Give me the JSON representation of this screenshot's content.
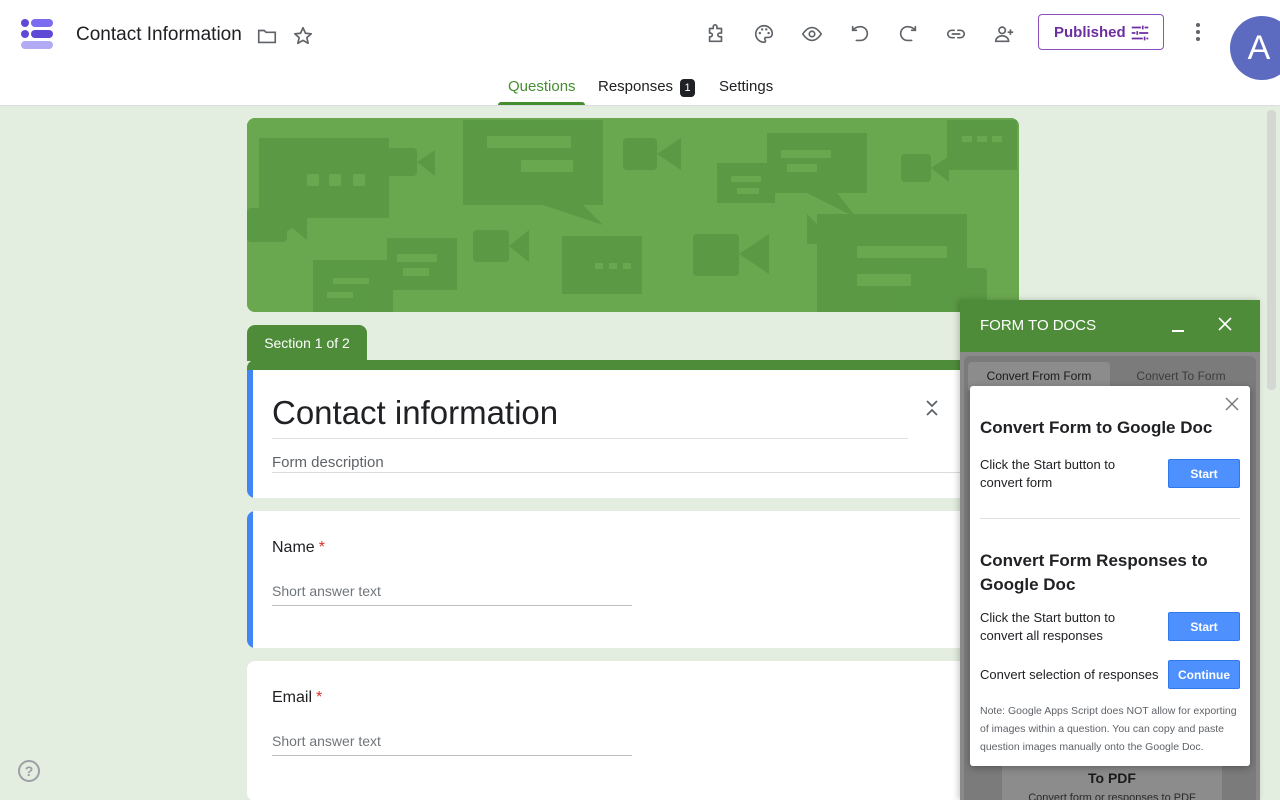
{
  "header": {
    "title": "Contact Information",
    "published_label": "Published",
    "avatar_letter": "A"
  },
  "tabs": {
    "questions": "Questions",
    "responses": "Responses",
    "responses_count": "1",
    "settings": "Settings"
  },
  "form": {
    "section_label": "Section 1 of 2",
    "title": "Contact information",
    "description_placeholder": "Form description",
    "questions": [
      {
        "label": "Name",
        "required": "*",
        "answer_placeholder": "Short answer text"
      },
      {
        "label": "Email",
        "required": "*",
        "answer_placeholder": "Short answer text"
      }
    ]
  },
  "addon": {
    "title": "FORM TO DOCS",
    "tab_convert_from": "Convert From Form",
    "tab_convert_to": "Convert To Form",
    "dialog": {
      "heading1": "Convert Form to Google Doc",
      "text1": "Click the Start button to convert form",
      "btn1": "Start",
      "heading2": "Convert Form Responses to Google Doc",
      "text2": "Click the Start button to convert all responses",
      "btn2": "Start",
      "text3": "Convert selection of responses",
      "btn3": "Continue",
      "note": "Note: Google Apps Script does NOT allow for exporting of images within a question. You can copy and paste question images manually onto the Google Doc."
    },
    "pdf_title": "To PDF",
    "pdf_subtitle": "Convert form or responses to PDF"
  },
  "colors": {
    "accent_green": "#448d31",
    "section_green": "#4e8c3a",
    "published_purple": "#6b2fa0",
    "question_blue": "#4285f4",
    "button_blue": "#4d90fe"
  },
  "icons": [
    "forms-logo-icon",
    "folder-icon",
    "star-icon",
    "addon-puzzle-icon",
    "palette-icon",
    "preview-eye-icon",
    "undo-icon",
    "redo-icon",
    "link-icon",
    "add-person-icon",
    "tune-icon",
    "more-vert-icon",
    "collapse-icon",
    "help-icon",
    "minimize-icon",
    "close-icon"
  ]
}
